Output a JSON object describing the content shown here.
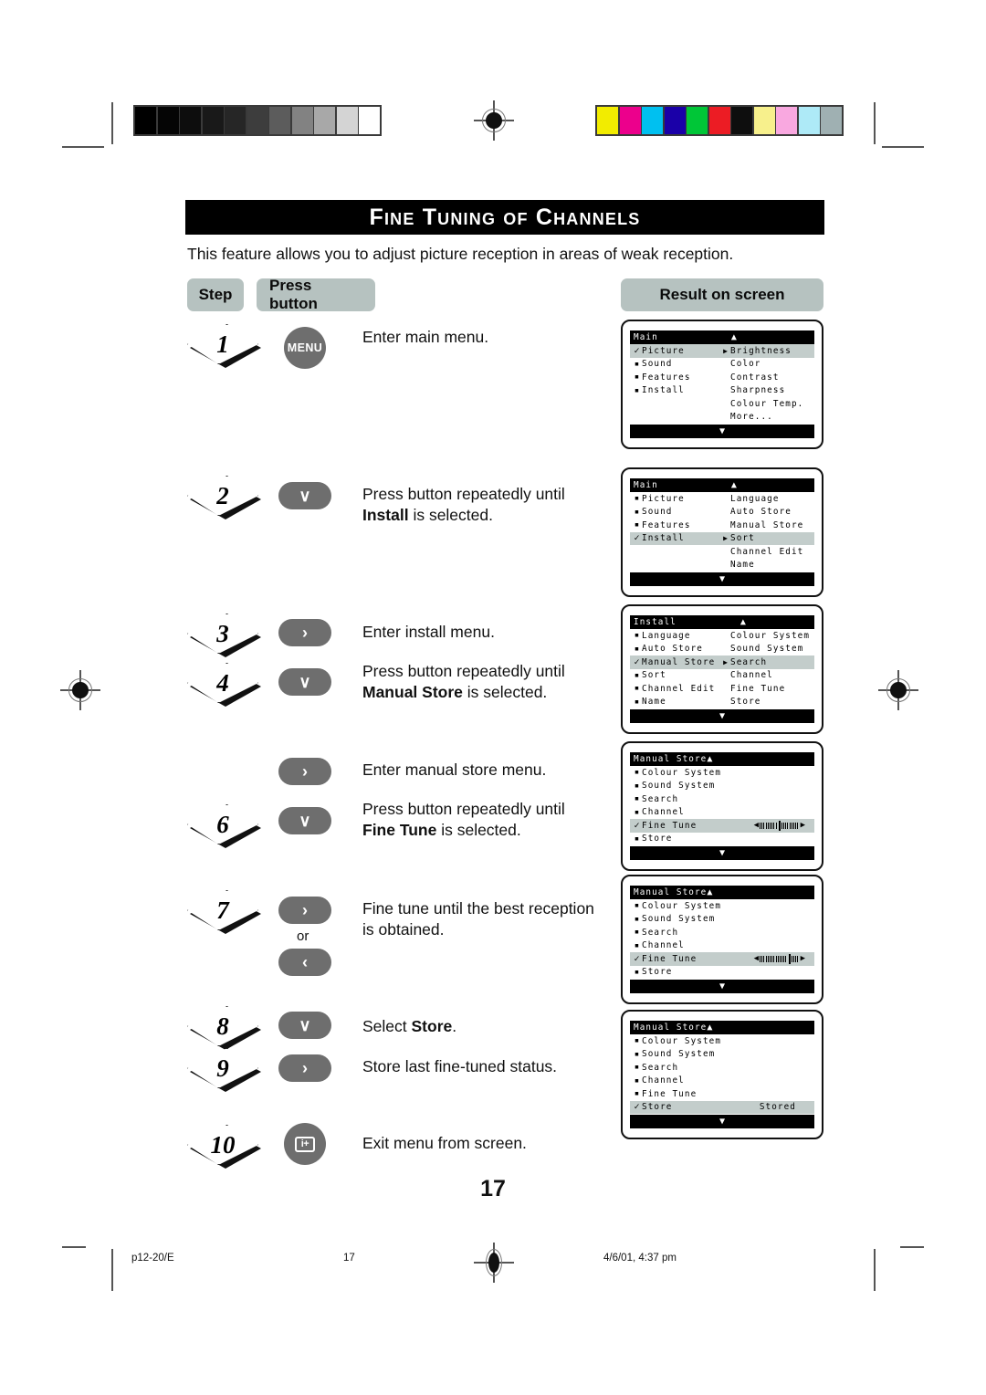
{
  "document": {
    "title": "Fine Tuning of Channels",
    "intro": "This feature allows you to adjust picture reception in areas of weak reception.",
    "page_number": "17"
  },
  "headers": {
    "step": "Step",
    "press_button": "Press button",
    "result_on_screen": "Result on screen"
  },
  "steps": [
    {
      "number": "1",
      "button_icon": "menu-button",
      "button_label": "MENU",
      "desc_line1": "Enter main menu.",
      "desc_bold": "",
      "desc_line2": ""
    },
    {
      "number": "2",
      "button_icon": "cursor-down-button",
      "button_label": "∨",
      "desc_line1": "Press button repeatedly until",
      "desc_bold": "Install",
      "desc_line2": " is selected."
    },
    {
      "number": "3",
      "button_icon": "cursor-right-button",
      "button_label": "›",
      "desc_line1": "Enter install menu.",
      "desc_bold": "",
      "desc_line2": ""
    },
    {
      "number": "4",
      "button_icon": "cursor-down-button",
      "button_label": "∨",
      "desc_line1": "Press button repeatedly until",
      "desc_bold": "Manual Store",
      "desc_line2": " is selected."
    },
    {
      "number": "",
      "button_icon": "cursor-right-button",
      "button_label": "›",
      "desc_line1": "Enter manual store menu.",
      "desc_bold": "",
      "desc_line2": ""
    },
    {
      "number": "6",
      "button_icon": "cursor-down-button",
      "button_label": "∨",
      "desc_line1": "Press button repeatedly until",
      "desc_bold": "Fine Tune",
      "desc_line2": " is selected."
    },
    {
      "number": "7",
      "button_icon": "cursor-right-button",
      "button_label": "›",
      "desc_line1": "Fine tune until the best reception",
      "desc_bold": "",
      "desc_line2": "is obtained.",
      "or_label": "or",
      "button_icon_alt": "cursor-left-button",
      "button_label_alt": "‹"
    },
    {
      "number": "8",
      "button_icon": "cursor-down-button",
      "button_label": "∨",
      "desc_line1": "Select ",
      "desc_bold": "Store",
      "desc_line2": "."
    },
    {
      "number": "9",
      "button_icon": "cursor-right-button",
      "button_label": "›",
      "desc_line1": "Store last fine-tuned status.",
      "desc_bold": "",
      "desc_line2": ""
    },
    {
      "number": "10",
      "button_icon": "exit-button",
      "button_label": "i+",
      "desc_line1": "Exit menu from screen.",
      "desc_bold": "",
      "desc_line2": ""
    }
  ],
  "osd_screens": [
    {
      "id": "osd-main-picture",
      "title": "Main",
      "title_arrow": "▲",
      "left_items": [
        {
          "mark": "✓",
          "label": "Picture",
          "selected": true,
          "arrow": "▶"
        },
        {
          "mark": "▪",
          "label": "Sound",
          "selected": false,
          "arrow": ""
        },
        {
          "mark": "▪",
          "label": "Features",
          "selected": false,
          "arrow": ""
        },
        {
          "mark": "▪",
          "label": "Install",
          "selected": false,
          "arrow": ""
        }
      ],
      "right_items": [
        "Brightness",
        "Color",
        "Contrast",
        "Sharpness",
        "Colour Temp.",
        "More..."
      ],
      "bottom_arrow": "▼"
    },
    {
      "id": "osd-main-install",
      "title": "Main",
      "title_arrow": "▲",
      "left_items": [
        {
          "mark": "▪",
          "label": "Picture",
          "selected": false,
          "arrow": ""
        },
        {
          "mark": "▪",
          "label": "Sound",
          "selected": false,
          "arrow": ""
        },
        {
          "mark": "▪",
          "label": "Features",
          "selected": false,
          "arrow": ""
        },
        {
          "mark": "✓",
          "label": "Install",
          "selected": true,
          "arrow": "▶"
        }
      ],
      "right_items": [
        "Language",
        "Auto Store",
        "Manual Store",
        "Sort",
        "Channel Edit",
        "Name"
      ],
      "bottom_arrow": "▼"
    },
    {
      "id": "osd-install-manualstore",
      "title": "Install",
      "title_arrow": "▲",
      "left_items": [
        {
          "mark": "▪",
          "label": "Language",
          "selected": false,
          "arrow": ""
        },
        {
          "mark": "▪",
          "label": "Auto Store",
          "selected": false,
          "arrow": ""
        },
        {
          "mark": "✓",
          "label": "Manual Store",
          "selected": true,
          "arrow": "▶"
        },
        {
          "mark": "▪",
          "label": "Sort",
          "selected": false,
          "arrow": ""
        },
        {
          "mark": "▪",
          "label": "Channel Edit",
          "selected": false,
          "arrow": ""
        },
        {
          "mark": "▪",
          "label": "Name",
          "selected": false,
          "arrow": ""
        }
      ],
      "right_items": [
        "Colour System",
        "Sound System",
        "Search",
        "Channel",
        "Fine Tune",
        "Store"
      ],
      "bottom_arrow": "▼"
    },
    {
      "id": "osd-manualstore-finetune-1",
      "title": "Manual Store",
      "title_arrow": "▲",
      "rows": [
        {
          "mark": "▪",
          "label": "Colour System",
          "selected": false
        },
        {
          "mark": "▪",
          "label": "Sound System",
          "selected": false
        },
        {
          "mark": "▪",
          "label": "Search",
          "selected": false
        },
        {
          "mark": "▪",
          "label": "Channel",
          "selected": false
        },
        {
          "mark": "✓",
          "label": "Fine Tune",
          "selected": true,
          "slider": {
            "ticks_left": 9,
            "ticks_right": 9
          }
        },
        {
          "mark": "▪",
          "label": "Store",
          "selected": false
        }
      ],
      "bottom_arrow": "▼"
    },
    {
      "id": "osd-manualstore-finetune-2",
      "title": "Manual Store",
      "title_arrow": "▲",
      "rows": [
        {
          "mark": "▪",
          "label": "Colour System",
          "selected": false
        },
        {
          "mark": "▪",
          "label": "Sound System",
          "selected": false
        },
        {
          "mark": "▪",
          "label": "Search",
          "selected": false
        },
        {
          "mark": "▪",
          "label": "Channel",
          "selected": false
        },
        {
          "mark": "✓",
          "label": "Fine Tune",
          "selected": true,
          "slider": {
            "ticks_left": 14,
            "ticks_right": 4
          }
        },
        {
          "mark": "▪",
          "label": "Store",
          "selected": false
        }
      ],
      "bottom_arrow": "▼"
    },
    {
      "id": "osd-manualstore-stored",
      "title": "Manual Store",
      "title_arrow": "▲",
      "rows": [
        {
          "mark": "▪",
          "label": "Colour System",
          "selected": false
        },
        {
          "mark": "▪",
          "label": "Sound System",
          "selected": false
        },
        {
          "mark": "▪",
          "label": "Search",
          "selected": false
        },
        {
          "mark": "▪",
          "label": "Channel",
          "selected": false
        },
        {
          "mark": "▪",
          "label": "Fine Tune",
          "selected": false
        },
        {
          "mark": "✓",
          "label": "Store",
          "selected": true,
          "value": "Stored"
        }
      ],
      "bottom_arrow": "▼"
    }
  ],
  "print_marks": {
    "gray_wedge": [
      "#000000",
      "#050505",
      "#0d0d0d",
      "#191919",
      "#262626",
      "#3d3d3d",
      "#5c5c5c",
      "#828282",
      "#a8a8a8",
      "#d4d4d4",
      "#ffffff"
    ],
    "color_bars": [
      "#f2ec00",
      "#ec008c",
      "#00c0f0",
      "#1a00a8",
      "#00c637",
      "#ec1c24",
      "#0e0e0e",
      "#f7f08c",
      "#f9a8e0",
      "#aeeaf7",
      "#9fb0b2"
    ]
  },
  "footer": {
    "file_label": "p12-20/E",
    "page": "17",
    "timestamp": "4/6/01, 4:37 pm"
  }
}
